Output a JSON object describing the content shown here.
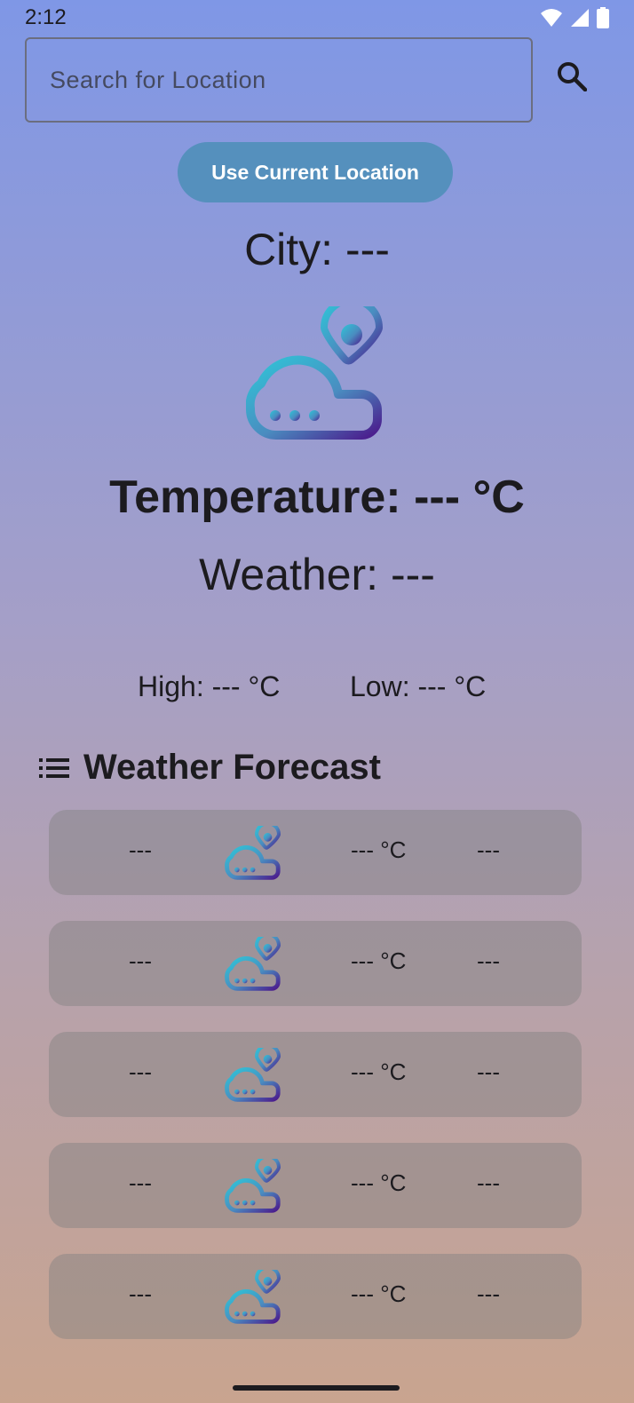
{
  "status_bar": {
    "time": "2:12"
  },
  "search": {
    "placeholder": "Search for Location"
  },
  "location_button": {
    "label": "Use Current Location"
  },
  "current": {
    "city": "City: ---",
    "temperature": "Temperature: --- °C",
    "weather": "Weather: ---",
    "high": "High: --- °C",
    "low": "Low: --- °C",
    "icon": "cloud-location-icon"
  },
  "forecast": {
    "title": "Weather Forecast",
    "items": [
      {
        "day": "---",
        "temp": "--- °C",
        "condition": "---"
      },
      {
        "day": "---",
        "temp": "--- °C",
        "condition": "---"
      },
      {
        "day": "---",
        "temp": "--- °C",
        "condition": "---"
      },
      {
        "day": "---",
        "temp": "--- °C",
        "condition": "---"
      },
      {
        "day": "---",
        "temp": "--- °C",
        "condition": "---"
      }
    ]
  },
  "colors": {
    "button": "#5590bd",
    "icon_gradient_start": "#2fc6d8",
    "icon_gradient_end": "#4b1a8c"
  }
}
